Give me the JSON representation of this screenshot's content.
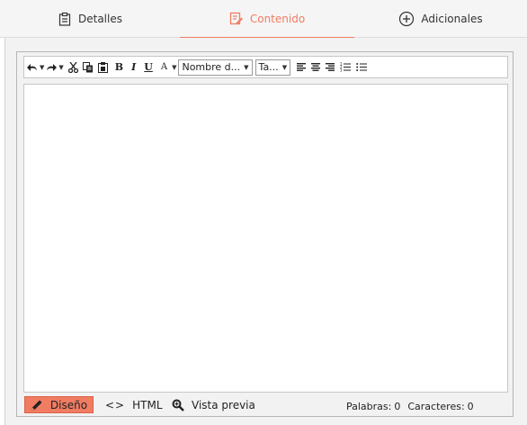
{
  "tabs": {
    "details": {
      "label": "Detalles",
      "icon": "clipboard-icon"
    },
    "content": {
      "label": "Contenido",
      "icon": "edit-document-icon",
      "active": true
    },
    "additional": {
      "label": "Adicionales",
      "icon": "plus-circle-icon"
    }
  },
  "toolbar": {
    "font_name": "Nombre d...",
    "font_size": "Ta...",
    "bold": "B",
    "italic": "I",
    "underline": "U",
    "font_color": "A"
  },
  "modes": {
    "design": "Diseño",
    "html": "HTML",
    "preview": "Vista previa"
  },
  "status": {
    "words_label": "Palabras:",
    "words": "0",
    "chars_label": "Caracteres:",
    "chars": "0"
  },
  "colors": {
    "accent": "#f07c62",
    "panel": "#f2f2f2",
    "tabbar": "#f5f5f5"
  }
}
